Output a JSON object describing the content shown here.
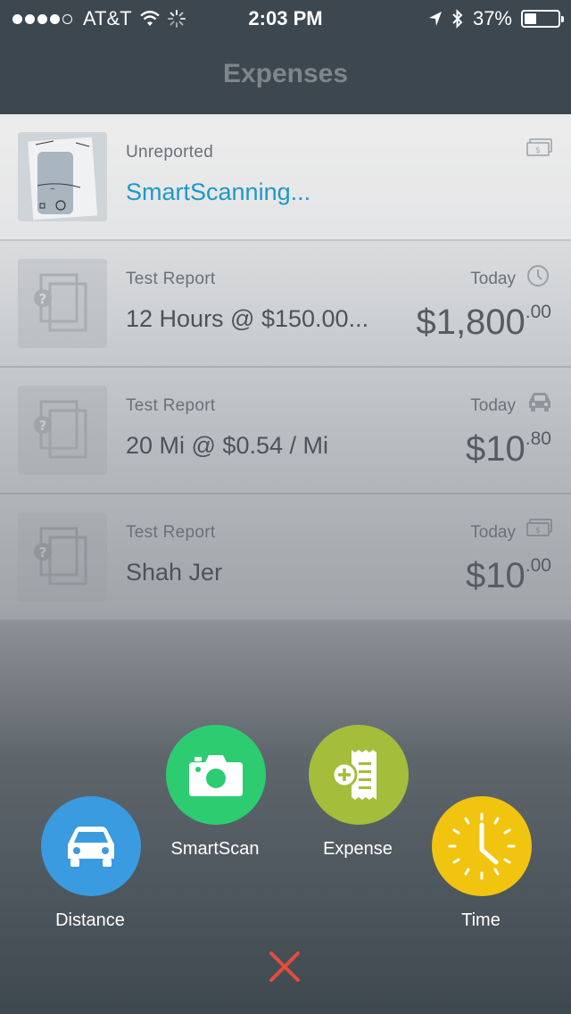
{
  "status_bar": {
    "carrier": "AT&T",
    "time": "2:03 PM",
    "battery": "37%",
    "battery_level": 0.37,
    "signal_bars": 4,
    "signal_total": 5
  },
  "nav": {
    "title": "Expenses"
  },
  "expenses": [
    {
      "report": "Unreported",
      "description": "SmartScanning...",
      "date": "",
      "amount_main": "",
      "amount_cents": "",
      "icon": "cash-icon"
    },
    {
      "report": "Test Report",
      "description": "12 Hours @ $150.00...",
      "date": "Today",
      "amount_main": "$1,800",
      "amount_cents": ".00",
      "icon": "clock-icon"
    },
    {
      "report": "Test Report",
      "description": "20 Mi @ $0.54 / Mi",
      "date": "Today",
      "amount_main": "$10",
      "amount_cents": ".80",
      "icon": "car-icon"
    },
    {
      "report": "Test Report",
      "description": "Shah Jer",
      "date": "Today",
      "amount_main": "$10",
      "amount_cents": ".00",
      "icon": "cash-icon"
    }
  ],
  "actions": {
    "distance": {
      "label": "Distance",
      "color": "#3a9be0",
      "icon": "car-icon"
    },
    "smartscan": {
      "label": "SmartScan",
      "color": "#2ecc71",
      "icon": "camera-icon"
    },
    "expense": {
      "label": "Expense",
      "color": "#a4bd3a",
      "icon": "receipt-add-icon"
    },
    "time": {
      "label": "Time",
      "color": "#f1c40f",
      "icon": "clock-icon"
    }
  },
  "close": {
    "icon": "close-icon",
    "color": "#e74c3c"
  }
}
